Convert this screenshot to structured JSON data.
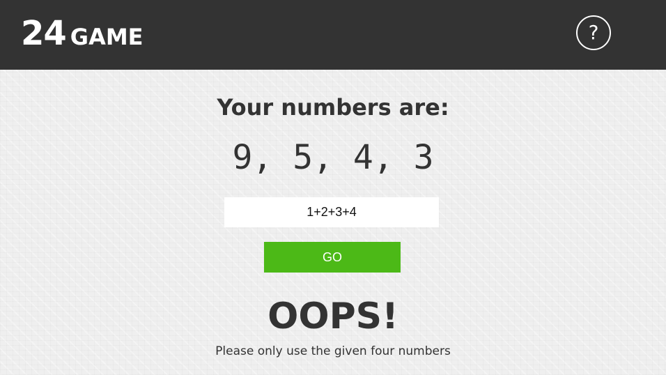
{
  "header": {
    "title_number": "24",
    "title_word": "GAME",
    "help_label": "?",
    "help_icon": "question-mark-circle-icon"
  },
  "main": {
    "prompt": "Your numbers are:",
    "numbers": "9, 5, 4, 3",
    "expression_value": "1+2+3+4",
    "go_label": "GO",
    "result_title": "OOPS!",
    "result_message": "Please only use the given four numbers"
  },
  "colors": {
    "header_background": "#333333",
    "go_button": "#4cb917",
    "text": "#333333"
  }
}
